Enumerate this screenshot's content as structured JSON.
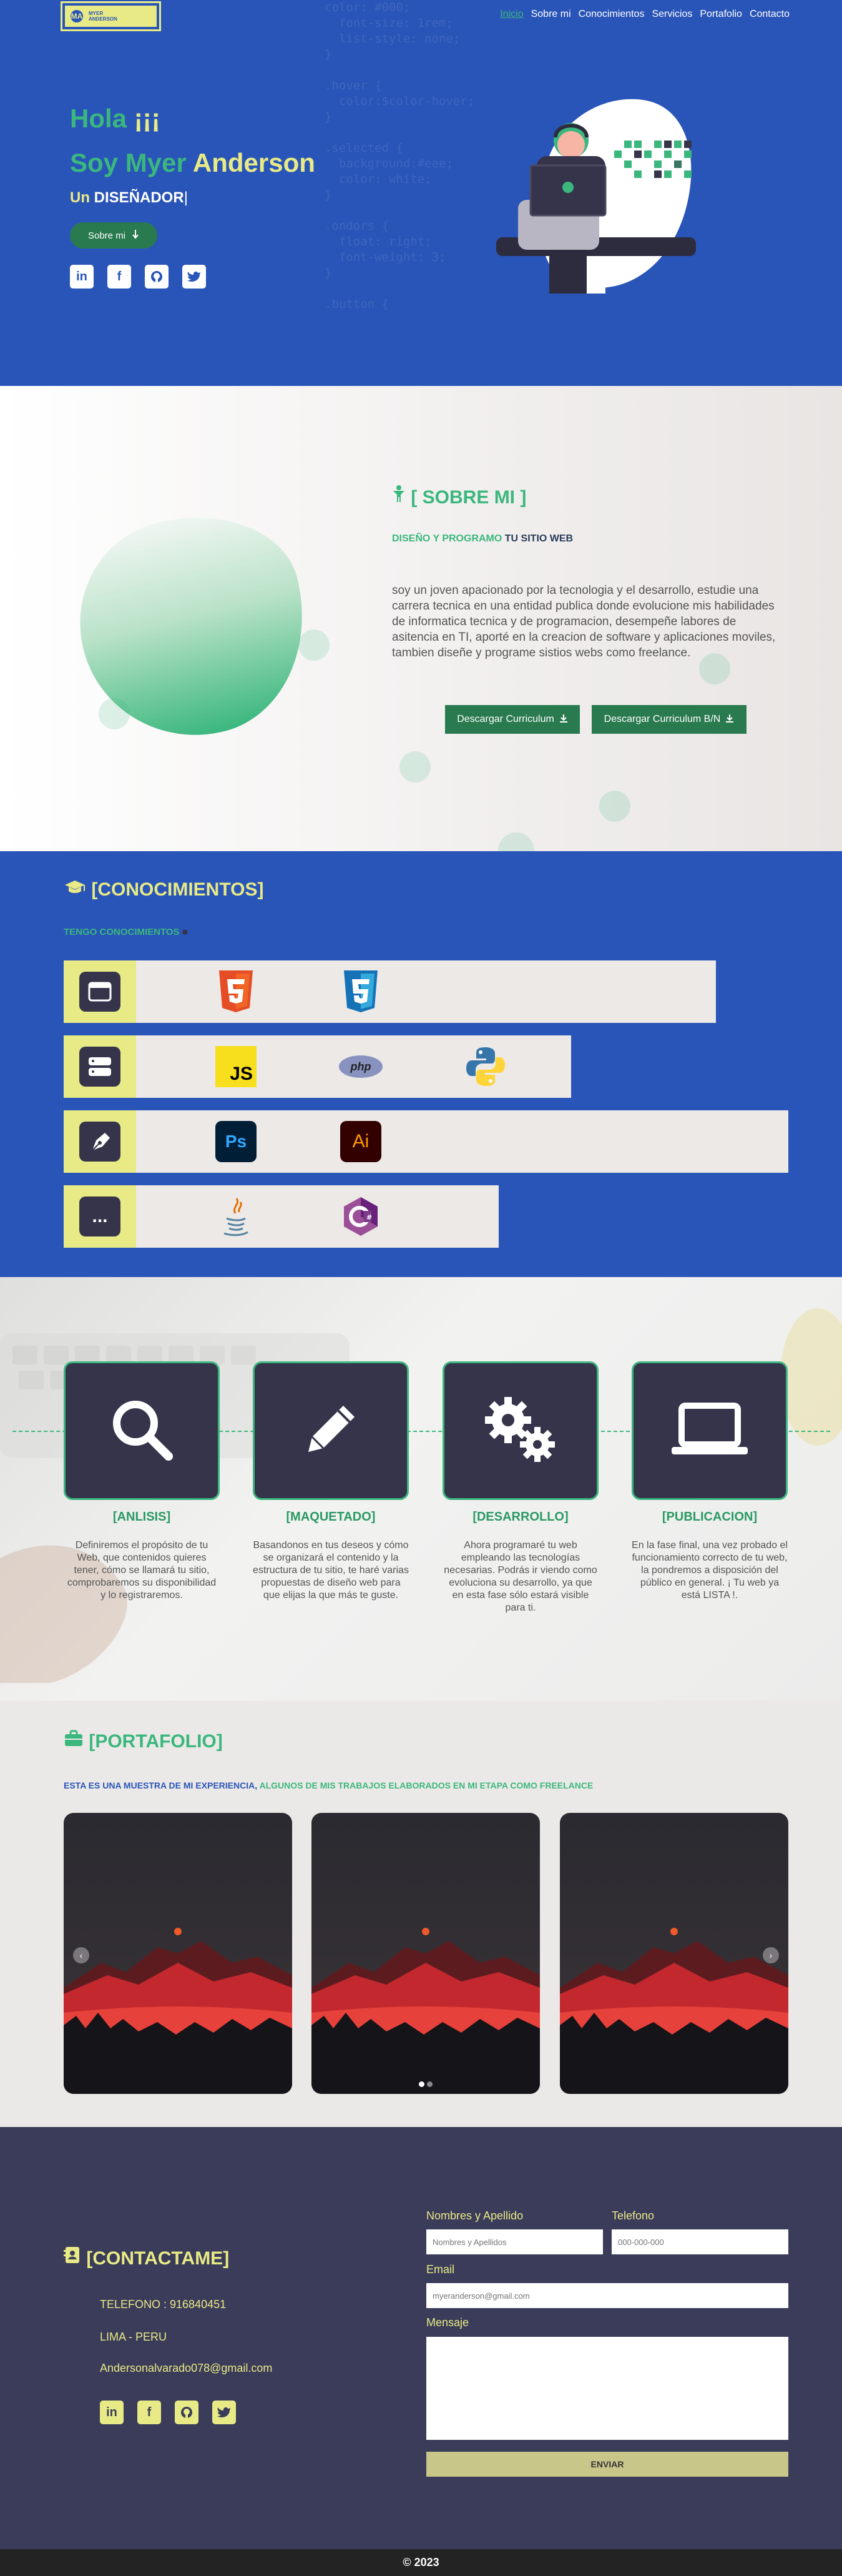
{
  "brand": {
    "logo_text_1": "MYER",
    "logo_text_2": "ANDERSON",
    "logo_initials": "MA"
  },
  "nav": {
    "items": [
      "Inicio",
      "Sobre mi",
      "Conocimientos",
      "Servicios",
      "Portafolio",
      "Contacto"
    ],
    "active": "Inicio"
  },
  "hero": {
    "hola": "Hola",
    "hola_mark": "¡¡¡",
    "soy": "Soy Myer",
    "name": "Anderson",
    "un": "Un",
    "role": "DISEÑADOR",
    "button": "Sobre mi",
    "code_text": "color: #000;\n  font-size: 1rem;\n  list-style: none;\n}\n\n.hover {\n  color:$color-hover;\n}\n\n.selected {\n  background:#eee;\n  color: white;\n}\n\n.ondors {\n  float: right;\n  font-weight: 3;\n}\n\n.button {",
    "social": [
      "linkedin-icon",
      "facebook-icon",
      "github-icon",
      "twitter-icon"
    ]
  },
  "about": {
    "title": "[ SOBRE MI ]",
    "subtitle_a": "DISEÑO Y PROGRAMO",
    "subtitle_b": "TU SITIO WEB",
    "text": "soy un joven apacionado por la tecnologia y el desarrollo, estudie una carrera tecnica en una entidad publica donde evolucione mis habilidades de informatica tecnica y de programacion, desempeñe labores de asitencia en TI, aporté en la creacion de software y aplicaciones moviles, tambien diseñe y programe sistios webs como freelance.",
    "btn_cv": "Descargar Curriculum",
    "btn_cv_bn": "Descargar Curriculum B/N"
  },
  "knowledge": {
    "title": "[CONOCIMIENTOS]",
    "subtitle": "TENGO CONOCIMIENTOS",
    "rows": [
      {
        "category": "frontend-icon",
        "skills": [
          "HTML5",
          "CSS3"
        ]
      },
      {
        "category": "backend-icon",
        "skills": [
          "JS",
          "php",
          "Python"
        ]
      },
      {
        "category": "design-icon",
        "skills": [
          "Ps",
          "Ai"
        ]
      },
      {
        "category": "more-icon",
        "skills": [
          "Java",
          "C#"
        ]
      }
    ],
    "more_label": "..."
  },
  "process": {
    "steps": [
      {
        "title": "[ANLISIS]",
        "text": "Definiremos el propósito de tu Web, que contenidos quieres tener, cómo se llamará tu sitio, comprobaremos su disponibilidad y lo registraremos."
      },
      {
        "title": "[MAQUETADO]",
        "text": "Basandonos en tus deseos y cómo se organizará el contenido y la estructura de tu sitio, te haré varias propuestas de diseño web para que elijas la que más te guste."
      },
      {
        "title": "[DESARROLLO]",
        "text": "Ahora programaré tu web empleando las tecnologías necesarias. Podrás ir viendo como evoluciona su desarrollo, ya que en esta fase sólo estará visible para ti."
      },
      {
        "title": "[PUBLICACION]",
        "text": "En la fase final, una vez probado el funcionamiento correcto de tu web, la pondremos a disposición del público en general. ¡ Tu web ya está LISTA !."
      }
    ]
  },
  "portfolio": {
    "title": "[PORTAFOLIO]",
    "subtitle_a": "ESTA ES UNA MUESTRA DE MI EXPERIENCIA,",
    "subtitle_b": "ALGUNOS DE MIS TRABAJOS ELABORADOS EN MI ETAPA COMO FREELANCE",
    "prev": "‹",
    "next": "›"
  },
  "contact": {
    "title": "[CONTACTAME]",
    "phone": "TELEFONO : 916840451",
    "location": "LIMA - PERU",
    "email": "Andersonalvarado078@gmail.com",
    "form": {
      "name_label": "Nombres y Apellido",
      "name_placeholder": "Nombres y Apellidos",
      "phone_label": "Telefono",
      "phone_placeholder": "000-000-000",
      "email_label": "Email",
      "email_placeholder": "myeranderson@gmail.com",
      "message_label": "Mensaje",
      "send": "ENVIAR"
    }
  },
  "footer": {
    "text": "© 2023"
  },
  "colors": {
    "blue": "#2955b8",
    "green": "#3bb77e",
    "yellow": "#e8ea86",
    "navy": "#35344b",
    "contact_bg": "#3a3c5a"
  }
}
